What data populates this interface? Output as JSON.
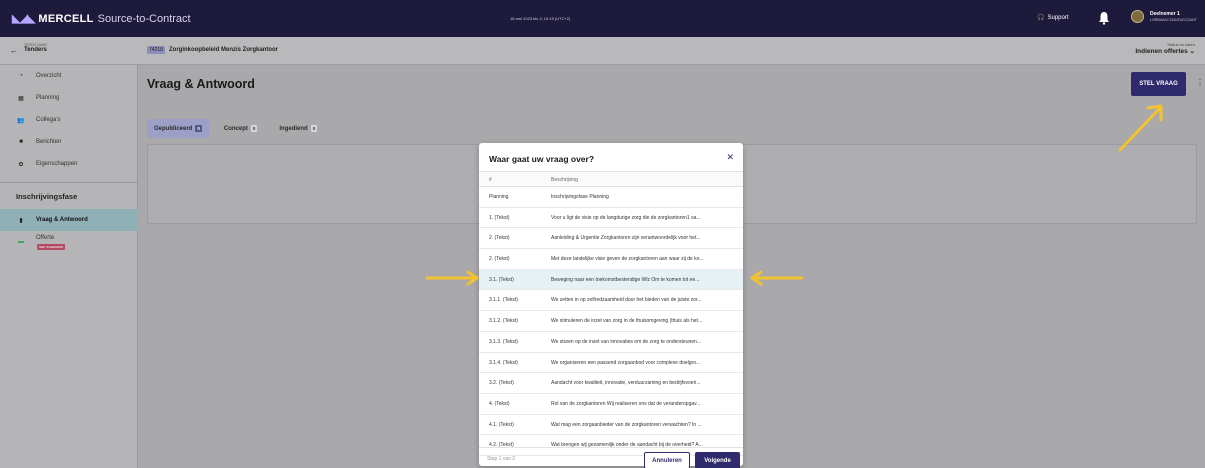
{
  "topbar": {
    "brand": "MERCELL",
    "product": "Source-to-Contract",
    "center_text": "18 aml 2023 bis 3, 10:15 (UTC+2)",
    "support": "Support",
    "user_name": "Deelnemer 1",
    "user_sub": "LOREMACCOUNTACCOUNT"
  },
  "subbar": {
    "back_small": "TERUG NAAR",
    "back_label": "Tenders",
    "tender_id": "74218",
    "tender_title": "Zorginkoopbeleid Menzis Zorgkantoor",
    "status_small": "Status en taken",
    "status_main": "Indienen offertes"
  },
  "sidebar": {
    "items": [
      {
        "label": "Overzicht",
        "icon": "overview-icon"
      },
      {
        "label": "Planning",
        "icon": "calendar-icon"
      },
      {
        "label": "Collega's",
        "icon": "people-icon"
      },
      {
        "label": "Berichten",
        "icon": "message-icon"
      },
      {
        "label": "Eigenschappen",
        "icon": "gear-icon"
      }
    ],
    "section": "Inschrijvingsfase",
    "phase_items": [
      {
        "label": "Vraag & Antwoord",
        "icon": "qa-icon"
      },
      {
        "label": "Offerte",
        "icon": "offer-icon",
        "badge": "NIET INGEDIEND"
      }
    ]
  },
  "main": {
    "title": "Vraag & Antwoord",
    "ask_button": "STEL VRAAG",
    "tabs": [
      {
        "label": "Gepubliceerd",
        "count": "0"
      },
      {
        "label": "Concept",
        "count": "0"
      },
      {
        "label": "Ingediend",
        "count": "0"
      }
    ]
  },
  "modal": {
    "title": "Waar gaat uw vraag over?",
    "col_num": "#",
    "col_desc": "Beschrijving",
    "rows": [
      {
        "num": "Planning",
        "desc": "Inschrijvingsfase Planning"
      },
      {
        "num": "1. (Tekst)",
        "desc": "Voor u ligt de visie op de langdurige zorg die de zorgkantoren1 sa..."
      },
      {
        "num": "2. (Tekst)",
        "desc": "Aanleiding & Urgentie Zorgkantoren zijn verantwoordelijk voor het..."
      },
      {
        "num": "2. (Tekst)",
        "desc": "Met deze landelijke visie geven de zorgkantoren aan waar zij de ko..."
      },
      {
        "num": "3.1. (Tekst)",
        "desc": "Beweging naar een toekomstbestendige Wlz Om te komen tot ee..."
      },
      {
        "num": "3.1.1. (Tekst)",
        "desc": "We zetten in op zelfredzaamheid door het bieden van de juiste zor..."
      },
      {
        "num": "3.1.2. (Tekst)",
        "desc": "We stimuleren de inzet van zorg in de thuisomgeving (thuis als het..."
      },
      {
        "num": "3.1.3. (Tekst)",
        "desc": "We sturen op de inzet van innovaties om de zorg te ondersteunen..."
      },
      {
        "num": "3.1.4. (Tekst)",
        "desc": "We organiseren een passend zorgaanbod voor complexe doelgro..."
      },
      {
        "num": "3.2. (Tekst)",
        "desc": "Aandacht voor kwaliteit, innovatie, verduurzaming en bedrijfsvoeri..."
      },
      {
        "num": "4. (Tekst)",
        "desc": "Rol van de zorgkantoren Wij realiseren ons dat de veranderopgav..."
      },
      {
        "num": "4.1. (Tekst)",
        "desc": "Wat mag een zorgaanbieder van de zorgkantoren verwachten? In ..."
      },
      {
        "num": "4.2. (Tekst)",
        "desc": "Wat brengen wij gezamenlijk onder de aandacht bij de overheid? A..."
      }
    ],
    "step": "Stap 1 van 2",
    "cancel": "Annuleren",
    "next": "Volgende"
  },
  "colors": {
    "brand": "#1e1a3c",
    "primary": "#2e2a6b",
    "highlight_row": "#e6f1f6",
    "annotation_arrow": "#f2c230"
  }
}
